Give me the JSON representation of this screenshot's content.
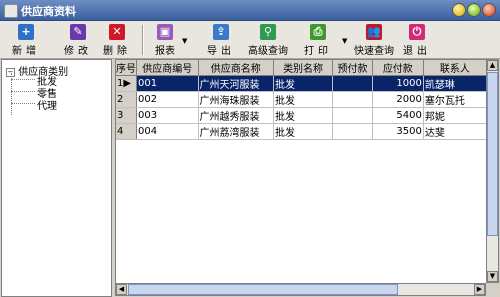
{
  "window": {
    "title": "供应商资料"
  },
  "toolbar": {
    "new": "新增",
    "edit": "修改",
    "delete": "删除",
    "report": "报表",
    "export": "导出",
    "advanced_query": "高级查询",
    "print": "打印",
    "quick_query": "快速查询",
    "exit": "退出"
  },
  "tree": {
    "root": "供应商类别",
    "children": [
      "批发",
      "零售",
      "代理"
    ]
  },
  "grid": {
    "columns": [
      "序号",
      "供应商编号",
      "供应商名称",
      "类别名称",
      "预付款",
      "应付款",
      "联系人"
    ],
    "rows": [
      {
        "idx": "1",
        "code": "001",
        "name": "广州天河服装",
        "category": "批发",
        "prepay": "",
        "payable": "1000",
        "contact": "凯瑟琳"
      },
      {
        "idx": "2",
        "code": "002",
        "name": "广州海珠服装",
        "category": "批发",
        "prepay": "",
        "payable": "2000",
        "contact": "塞尔瓦托"
      },
      {
        "idx": "3",
        "code": "003",
        "name": "广州越秀服装",
        "category": "批发",
        "prepay": "",
        "payable": "5400",
        "contact": "邦妮"
      },
      {
        "idx": "4",
        "code": "004",
        "name": "广州荔湾服装",
        "category": "批发",
        "prepay": "",
        "payable": "3500",
        "contact": "达斐"
      }
    ],
    "selected_row": 0
  },
  "colors": {
    "title_bar": "#3a5f9e",
    "selection": "#0a246a"
  }
}
